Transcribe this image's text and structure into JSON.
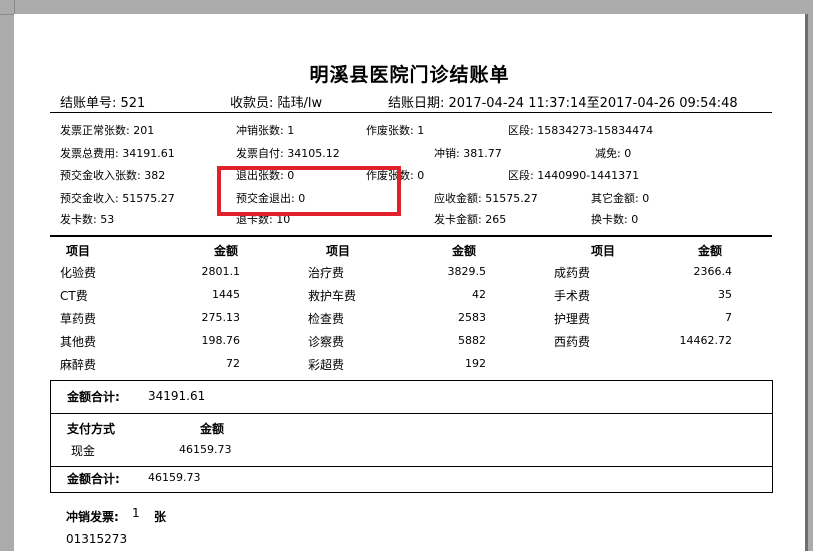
{
  "title": "明溪县医院门诊结账单",
  "header": {
    "bill_no": "结账单号: 521",
    "cashier": "收款员: 陆玮/lw",
    "date": "结账日期: 2017-04-24 11:37:14至2017-04-26 09:54:48"
  },
  "summary": {
    "r1": [
      "发票正常张数: 201",
      "冲销张数: 1",
      "作废张数: 1",
      "区段: 15834273-15834474"
    ],
    "r2": [
      "发票总费用: 34191.61",
      "发票自付: 34105.12",
      "冲销: 381.77",
      "减免: 0"
    ],
    "r3": [
      "预交金收入张数: 382",
      "退出张数: 0",
      "作废张数: 0",
      "区段: 1440990-1441371"
    ],
    "r3_visible": [
      "退出张数: 0",
      "作废张数: 0"
    ],
    "r4": [
      "预交金收入: 51575.27",
      "预交金退出: 0",
      "应收金额: 51575.27",
      "其它金额: 0"
    ],
    "r5": [
      "发卡数: 53",
      "退卡数: 10",
      "发卡金额: 265",
      "换卡数: 0"
    ]
  },
  "fees": {
    "headers": [
      "项目",
      "金额"
    ],
    "col1": [
      [
        "化验费",
        "2801.1"
      ],
      [
        "CT费",
        "1445"
      ],
      [
        "草药费",
        "275.13"
      ],
      [
        "其他费",
        "198.76"
      ],
      [
        "麻醉费",
        "72"
      ]
    ],
    "col2": [
      [
        "治疗费",
        "3829.5"
      ],
      [
        "救护车费",
        "42"
      ],
      [
        "检查费",
        "2583"
      ],
      [
        "诊察费",
        "5882"
      ],
      [
        "彩超费",
        "192"
      ]
    ],
    "col3": [
      [
        "成药费",
        "2366.4"
      ],
      [
        "手术费",
        "35"
      ],
      [
        "护理费",
        "7"
      ],
      [
        "西药费",
        "14462.72"
      ]
    ]
  },
  "total1": {
    "label": "金额合计:",
    "value": "34191.61"
  },
  "payment": {
    "headers": [
      "支付方式",
      "金额"
    ],
    "rows": [
      [
        "现金",
        "46159.73"
      ]
    ]
  },
  "total2": {
    "label": "金额合计:",
    "value": "46159.73"
  },
  "void": {
    "label": "冲销发票:",
    "count": "1",
    "unit": "张",
    "number": "01315273"
  },
  "highlight_color": "#e1202e"
}
